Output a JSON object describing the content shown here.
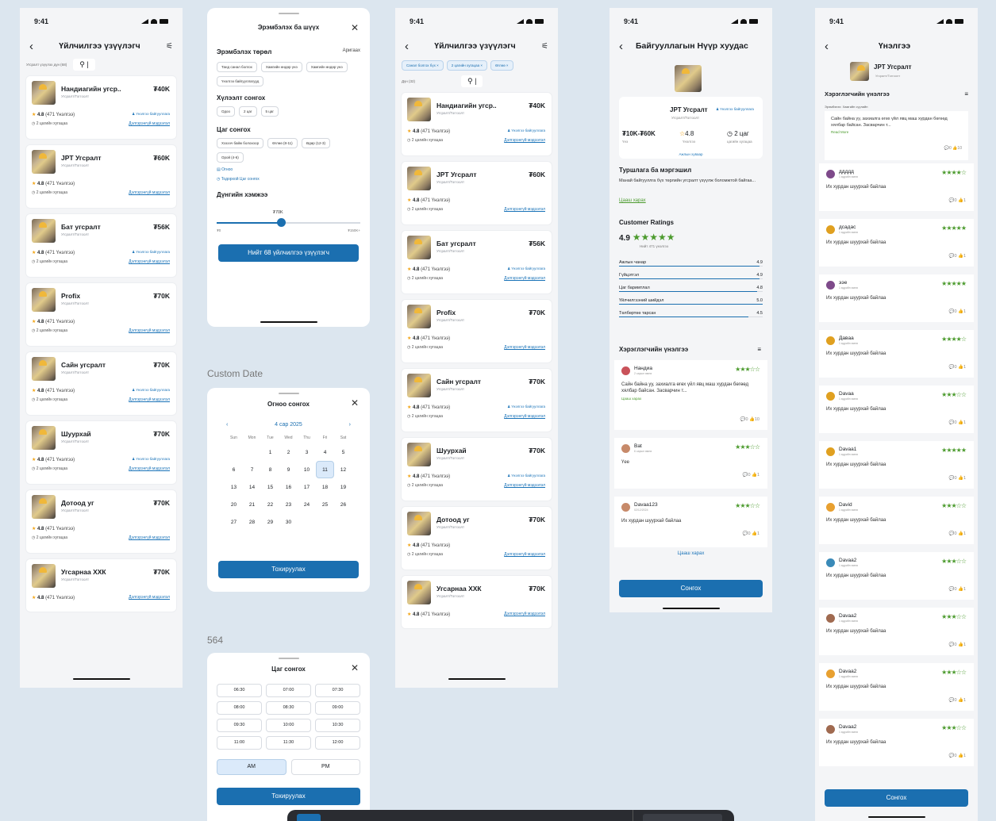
{
  "status_time": "9:41",
  "list_header_title": "Үйлчилгээ үзүүлэгч",
  "list_count": "Угсралт үзүүлэх дүн (68)",
  "chips_filtered": [
    "Санал болгох бүх ×",
    "2 цагийн хугацаа ×",
    "Өглөө ×"
  ],
  "list_count2": "Дүн (32)",
  "providers": [
    {
      "name": "Нандиагийн угср..",
      "price": "₮40K",
      "badge": true
    },
    {
      "name": "JPT Угсралт",
      "price": "₮60K",
      "badge": false
    },
    {
      "name": "Бат угсралт",
      "price": "₮56K",
      "badge": true
    },
    {
      "name": "Profix",
      "price": "₮70K",
      "badge": false
    },
    {
      "name": "Сайн угсралт",
      "price": "₮70K",
      "badge": true
    },
    {
      "name": "Шуурхай",
      "price": "₮70K",
      "badge": true
    },
    {
      "name": "Дотоод уг",
      "price": "₮70K",
      "badge": false
    },
    {
      "name": "Угсарнаа ХХК",
      "price": "₮70K",
      "badge": false
    }
  ],
  "provider_sub": "Угсралт/Тоггоолт",
  "provider_rating": "4.8",
  "provider_reviews": "(471 Үнэлгээ)",
  "provider_time": "2 цагийн хугацаа",
  "provider_badge": "Үнэлгээ байгууллага",
  "provider_link": "Дэлгэрэнгүй мэдээлэл",
  "filter": {
    "title": "Эрэмбэлэх ба шүүх",
    "sort_title": "Эрэмбэлэх төрөл",
    "sort_value": "Аригаах",
    "sort_chips": [
      "Танд санал болгох",
      "Хамгийн өндөр үнэ",
      "Хамгийн өндөр үнэ",
      "Үнэлгээ байгууллагууд"
    ],
    "duration_title": "Хүлээлт сонгох",
    "duration_chips": [
      "Одоо",
      "2 цаг",
      "5 цаг"
    ],
    "time_title": "Цаг сонгох",
    "time_chips": [
      "Хэзээч байж болохоор",
      "Өглөө (8-11)",
      "Өдөр (12-3)",
      "Орой (4-6)"
    ],
    "date_link": "Огноо",
    "specific_time": "Тодорхой Цаг сонгох",
    "price_title": "Дүнгийн хэмжээ",
    "price_value": "₮70K",
    "price_min": "₮0",
    "price_max": "₮150K+",
    "price_fraction": 0.45,
    "apply": "Нийт 68 үйлчилгээ үзүүлэгч"
  },
  "custom_date_label": "Custom Date",
  "calendar": {
    "title": "Огноо сонгох",
    "month": "4 сар 2025",
    "weekdays": [
      "Sun",
      "Mon",
      "Tue",
      "Wed",
      "Thu",
      "Fri",
      "Sat"
    ],
    "weeks": [
      [
        "",
        "",
        "1",
        "2",
        "3",
        "4",
        "5"
      ],
      [
        "6",
        "7",
        "8",
        "9",
        "10",
        "11",
        "12"
      ],
      [
        "13",
        "14",
        "15",
        "16",
        "17",
        "18",
        "19"
      ],
      [
        "20",
        "21",
        "22",
        "23",
        "24",
        "25",
        "26"
      ],
      [
        "27",
        "28",
        "29",
        "30",
        "",
        "",
        ""
      ]
    ],
    "selected": "11",
    "apply": "Тохируулах"
  },
  "time_label_num": "564",
  "time_picker": {
    "title": "Цаг сонгох",
    "slots": [
      "06:30",
      "07:00",
      "07:30",
      "08:00",
      "08:30",
      "09:00",
      "09:30",
      "10:00",
      "10:30",
      "11:00",
      "11:30",
      "12:00"
    ],
    "am": "AM",
    "pm": "PM",
    "apply": "Тохируулах"
  },
  "detail": {
    "header": "Байгууллагын Нүүр хуудас",
    "name": "JPT Угсралт",
    "badge": "Үнэлгээ байгууллага",
    "sub": "Угсралт/Тоггоолт",
    "price": "₮10K-₮60K",
    "price_label": "Үнэ",
    "rating": "4.8",
    "rating_label": "Үнэлгээ",
    "time": "2 цаг",
    "time_label": "цагийн хугацаа",
    "more_link": "Ажлын хуваар",
    "intro_title": "Туршлага ба мэргэшил",
    "intro": "Манай байгууллга бүх төрлийн угсралт үзүүлж боломжтой байгаа...",
    "intro_link": "Цааш харах",
    "ratings_title": "Customer Ratings",
    "score": "4.9",
    "stars": "★★★★★",
    "total": "Нийт 471 үнэлгээ",
    "metrics": [
      {
        "label": "Ажлын чанар",
        "value": "4.9"
      },
      {
        "label": "Гүйцэтгэл",
        "value": "4.9"
      },
      {
        "label": "Цаг баримтлал",
        "value": "4.8"
      },
      {
        "label": "Үйлчилгээний шийдэл",
        "value": "5.0"
      },
      {
        "label": "Төлбөртөө тарсан",
        "value": "4.5"
      }
    ],
    "reviews_title": "Хэрэглэгчийн үнэлгээ",
    "reviews": [
      {
        "name": "Нандиа",
        "sub": "2 сарын өмнө",
        "stars": "★★★☆☆",
        "text": "Сайн байна уу, захиалга өгөх үйл явц маш хурдан бөгөөд хялбар байсан. Засварчин т...",
        "more": "Цааш харах",
        "icons": "💬0 👍10"
      },
      {
        "name": "Bat",
        "sub": "6 сарын өмнө",
        "stars": "★★★☆☆",
        "text": "Үее",
        "more": "",
        "icons": "💬0 👍1"
      },
      {
        "name": "Davaa123",
        "sub": "02/12/2024",
        "stars": "★★★☆☆",
        "text": "Их хурдан шуурхай байлаа",
        "more": "",
        "icons": "💬0 👍1"
      }
    ],
    "see_more": "Цааш харах",
    "cta": "Сонгох"
  },
  "reviews_page": {
    "header": "Үнэлгээ",
    "name": "JPT Угсралт",
    "sub": "Угсралт/Тоггоолт",
    "section": "Хэрэглэгчийн үнэлгээ",
    "filter": "Эрэмбэлэх: Хамгийн сүүлийн",
    "first_text": "Сайн байна уу, захиалга өгөх үйл явц маш хурдан бөгөөд хялбар байсан. Засварчин т...",
    "first_more": "Read More",
    "first_icons": "💬0 👍10",
    "items": [
      {
        "name": "ддддд",
        "stars": "★★★★☆",
        "color": "#7e4a8a"
      },
      {
        "name": "дсадас",
        "stars": "★★★★★",
        "color": "#e0a020"
      },
      {
        "name": "ээе",
        "stars": "★★★★★",
        "color": "#7e4a8a"
      },
      {
        "name": "Дaвaa",
        "stars": "★★★★☆",
        "color": "#e0a020"
      },
      {
        "name": "Davaa",
        "stars": "★★★☆☆",
        "color": "#e0a020"
      },
      {
        "name": "Davaa1",
        "stars": "★★★★★",
        "color": "#e0a020"
      },
      {
        "name": "David",
        "stars": "★★★☆☆",
        "color": "#e8a030"
      },
      {
        "name": "Davaa2",
        "stars": "★★★☆☆",
        "color": "#3a8ab8"
      },
      {
        "name": "Davaa2",
        "stars": "★★★☆☆",
        "color": "#a06a50"
      },
      {
        "name": "Davaa2",
        "stars": "★★★☆☆",
        "color": "#e8a030"
      },
      {
        "name": "Davaa2",
        "stars": "★★★☆☆",
        "color": "#a06a50"
      }
    ],
    "item_sub": "1 өдрийн өмнө",
    "item_text": "Их хурдан шуурхай байлаа",
    "item_icons": "💬0 👍1",
    "cta": "Сонгох"
  }
}
